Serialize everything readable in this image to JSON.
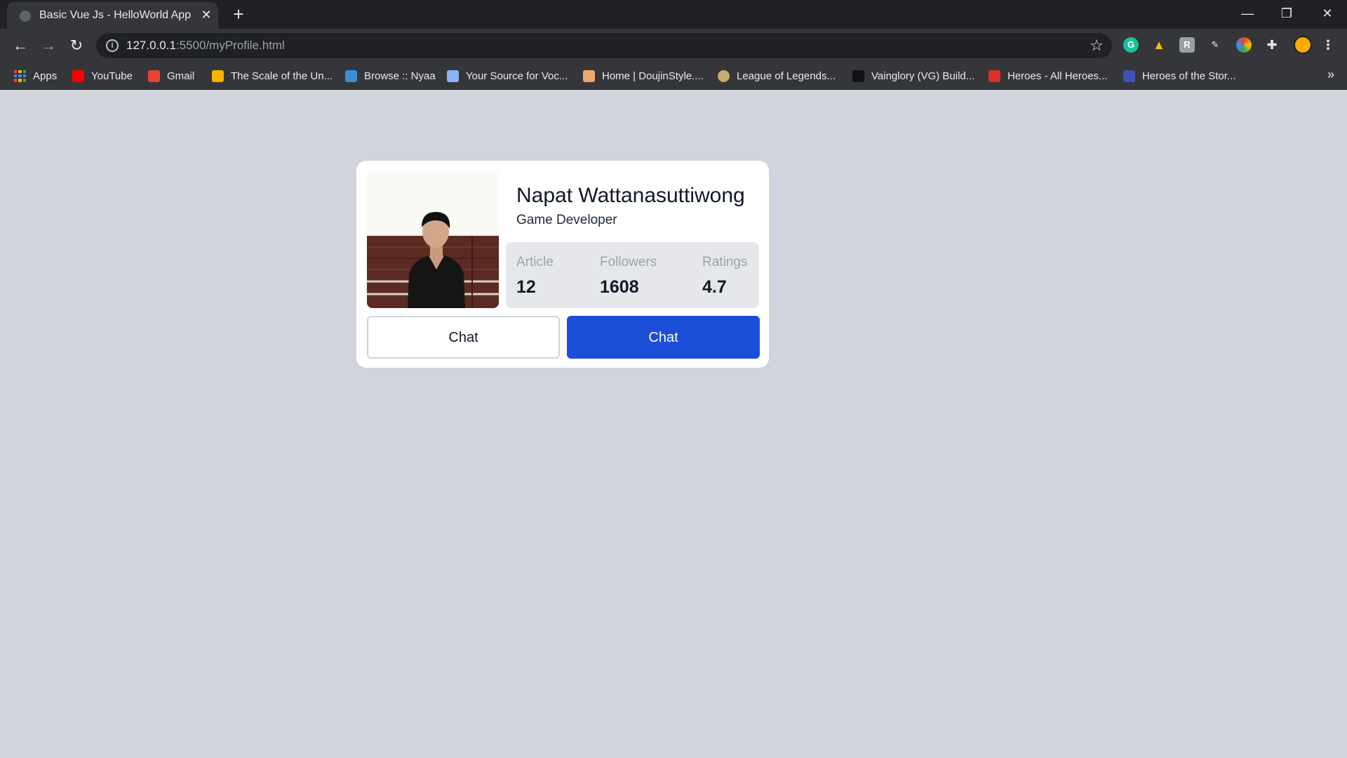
{
  "browser": {
    "tab_title": "Basic Vue Js - HelloWorld App",
    "tab_close": "✕",
    "new_tab": "+",
    "url_host": "127.0.0.1",
    "url_rest": ":5500/myProfile.html",
    "window_controls": {
      "minimize": "—",
      "restore": "❐",
      "close": "✕"
    },
    "extensions": [
      "grammarly-icon",
      "google-drive-icon",
      "extension-icon",
      "cursor-extension-icon",
      "color-picker-icon",
      "puzzle-icon",
      "profile-avatar-icon"
    ],
    "bookmarks": [
      {
        "label": "Apps",
        "icon": "apps-grid-icon"
      },
      {
        "label": "YouTube",
        "icon": "youtube-icon",
        "color": "#ff0000"
      },
      {
        "label": "Gmail",
        "icon": "gmail-icon",
        "color": "#ea4335"
      },
      {
        "label": "The Scale of the Un...",
        "icon": "scale-icon",
        "color": "#f4b400"
      },
      {
        "label": "Browse :: Nyaa",
        "icon": "nyaa-icon",
        "color": "#3c8dd9"
      },
      {
        "label": "Your Source for Voc...",
        "icon": "vocaloid-icon",
        "color": "#8ab4f8"
      },
      {
        "label": "Home | DoujinStyle....",
        "icon": "doujinstyle-icon",
        "color": "#e7a96b"
      },
      {
        "label": "League of Legends...",
        "icon": "league-icon",
        "color": "#c8aa6e"
      },
      {
        "label": "Vainglory (VG) Build...",
        "icon": "vainglory-icon",
        "color": "#111111"
      },
      {
        "label": "Heroes - All Heroes...",
        "icon": "heroes-d-icon",
        "color": "#d93025"
      },
      {
        "label": "Heroes of the Stor...",
        "icon": "hots-icon",
        "color": "#3f51b5"
      }
    ],
    "more_bookmarks": "»"
  },
  "profile": {
    "name": "Napat Wattanasuttiwong",
    "role": "Game Developer",
    "stats": [
      {
        "label": "Article",
        "value": "12"
      },
      {
        "label": "Followers",
        "value": "1608"
      },
      {
        "label": "Ratings",
        "value": "4.7"
      }
    ],
    "buttons": {
      "secondary": "Chat",
      "primary": "Chat"
    }
  }
}
